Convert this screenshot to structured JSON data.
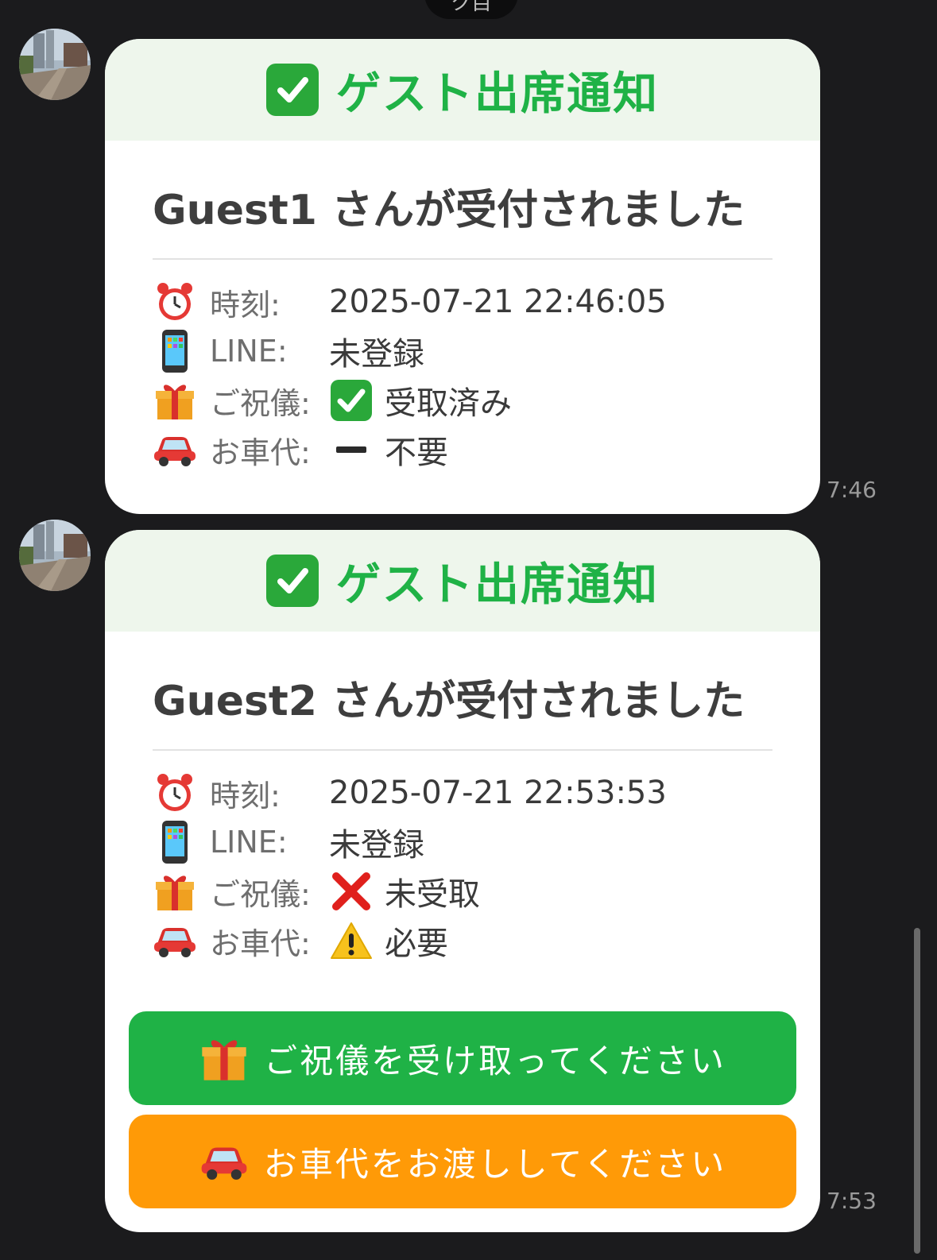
{
  "top_pill": {
    "text": "ク目"
  },
  "messages": [
    {
      "header_title": "ゲスト出席通知",
      "guest_title": "Guest1 さんが受付されました",
      "rows": [
        {
          "icon": "alarm-clock-icon",
          "label": "時刻:",
          "value_icon": "",
          "value": "2025-07-21 22:46:05"
        },
        {
          "icon": "mobile-phone-icon",
          "label": "LINE:",
          "value_icon": "",
          "value": "未登録"
        },
        {
          "icon": "gift-icon",
          "label": "ご祝儀:",
          "value_icon": "check-mark-icon",
          "value": "受取済み"
        },
        {
          "icon": "car-icon",
          "label": "お車代:",
          "value_icon": "minus-icon",
          "value": "不要"
        }
      ],
      "timestamp": "7:46"
    },
    {
      "header_title": "ゲスト出席通知",
      "guest_title": "Guest2 さんが受付されました",
      "rows": [
        {
          "icon": "alarm-clock-icon",
          "label": "時刻:",
          "value_icon": "",
          "value": "2025-07-21 22:53:53"
        },
        {
          "icon": "mobile-phone-icon",
          "label": "LINE:",
          "value_icon": "",
          "value": "未登録"
        },
        {
          "icon": "gift-icon",
          "label": "ご祝儀:",
          "value_icon": "cross-mark-icon",
          "value": "未受取"
        },
        {
          "icon": "car-icon",
          "label": "お車代:",
          "value_icon": "warning-icon",
          "value": "必要"
        }
      ],
      "buttons": [
        {
          "icon": "gift-icon",
          "label": "ご祝儀を受け取ってください",
          "color": "#1fb246"
        },
        {
          "icon": "car-icon",
          "label": "お車代をお渡ししてください",
          "color": "#ff9a07"
        }
      ],
      "timestamp": "7:53"
    }
  ],
  "colors": {
    "background": "#1b1b1d",
    "header_green": "#1fb246",
    "header_bg": "#eef6ec",
    "button_orange": "#ff9a07"
  }
}
